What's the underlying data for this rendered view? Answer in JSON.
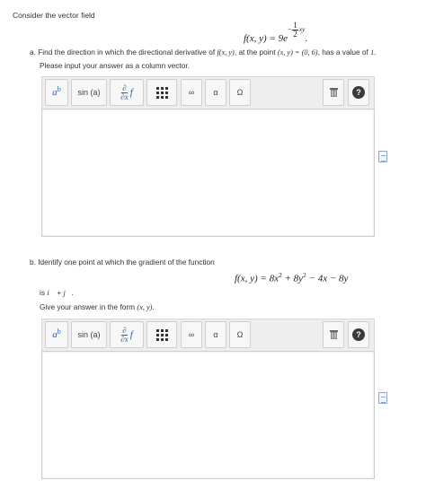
{
  "intro": "Consider the vector field",
  "part_a": {
    "formula": "f(x, y) = 9e^(−(1/2)xy)",
    "formula_lhs": "f(x, y) = 9e",
    "formula_exp_sign": "−",
    "formula_exp_num": "1",
    "formula_exp_den": "2",
    "formula_exp_var": "xy",
    "formula_end": ".",
    "question_prefix": "a. Find the direction in which the directional derivative of ",
    "question_f": "f(x, y)",
    "question_mid": ", at the point ",
    "question_xy": "(x, y) = (0, 6)",
    "question_suffix": ", has a value of ",
    "question_value": "1.",
    "instruction": "Please input your answer as a column vector."
  },
  "toolbar": {
    "power_base": "a",
    "power_exp": "b",
    "sin_label": "sin (a)",
    "partial_num": "∂",
    "partial_den": "∂x",
    "partial_f": "f",
    "infinity": "∞",
    "alpha": "α",
    "omega": "Ω",
    "help": "?"
  },
  "part_b": {
    "question": "b. Identify one point at which the gradient of the function",
    "formula_text": "f(x, y) = 8x² + 8y² − 4x − 8y",
    "f_lhs": "f(x, y) = 8x",
    "exp1": "2",
    "plus": " + 8y",
    "exp2": "2",
    "rest": " − 4x − 8y",
    "is_line": "is i⃗ + j⃗.",
    "is_prefix": "is ",
    "is_i": "i⃗",
    "is_plus": " + ",
    "is_j": "j⃗",
    "is_end": ".",
    "instruction_prefix": "Give your answer in the form ",
    "instruction_form": "(x, y)",
    "instruction_end": "."
  },
  "icons": {
    "trash": "trash-icon",
    "help": "help-icon",
    "matrix": "matrix-grid-icon",
    "attachment": "document-icon"
  }
}
